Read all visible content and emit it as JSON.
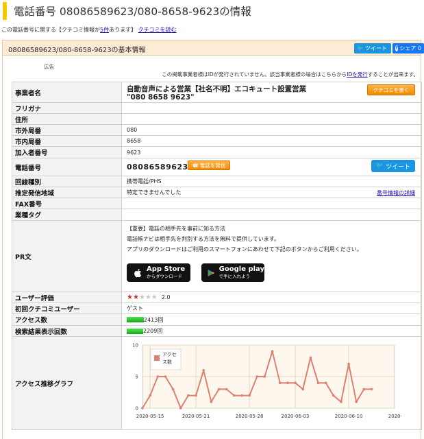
{
  "title": "電話番号 08086589623/080-8658-9623の情報",
  "info_line": {
    "prefix": "この電話番号に関する【クチコミ情報が",
    "count_link": "5件",
    "suffix": "あります】",
    "read_link": "クチコミを読む"
  },
  "section": {
    "title": "08086589623/080-8658-9623の基本情報",
    "tweet_label": "ツイート",
    "share_label": "シェア 0"
  },
  "ad_label": "広告",
  "id_note": {
    "prefix": "この掲載事業者様はIDが発行されていません。該当事業者様の場合はこちらから",
    "link": "IDを発行",
    "suffix": "することが出来ます。"
  },
  "labels": {
    "business_name": "事業者名",
    "furigana": "フリガナ",
    "address": "住所",
    "area_code": "市外局番",
    "local_code": "市内局番",
    "subscriber_no": "加入者番号",
    "phone_no": "電話番号",
    "line_type": "回線種別",
    "origin_area": "推定発信地域",
    "fax": "FAX番号",
    "industry_tag": "業種タグ",
    "pr": "PR文",
    "user_rating": "ユーザー評価",
    "first_reviewer": "初回クチコミユーザー",
    "access_count": "アクセス数",
    "search_count": "検索結果表示回数",
    "access_graph": "アクセス推移グラフ"
  },
  "values": {
    "business_name_line1": "自動音声による営業【社名不明】エコキュート設置営業",
    "business_name_line2": "\"080 8658 9623\"",
    "review_button": "クチコミを書く",
    "furigana": "",
    "address": "",
    "area_code": "080",
    "local_code": "8658",
    "subscriber_no": "9623",
    "phone_no": "08086589623",
    "call_button": "電話を発信",
    "tweet_button": "ツイート",
    "line_type": "携帯電話/PHS",
    "origin_area": "特定できませんでした",
    "detail_link": "番号情報の詳細",
    "fax": "",
    "industry_tag": "",
    "pr_line1": "【重要】電話の相手先を事前に知る方法",
    "pr_line2": "電話帳ナビは相手先を判別する方法を無料で提供しています。",
    "pr_line3": "アプリのダウンロードはご利用のスマートフォンにあわせて下記のボタンからご利用ください。",
    "app_store_main": "App Store",
    "app_store_sub": "からダウンロード",
    "google_play_main": "Google play",
    "google_play_sub": "で手に入れよう",
    "rating_value": "2.0",
    "rating_stars": 2,
    "rating_max": 5,
    "first_reviewer": "ゲスト",
    "access_count": "2413回",
    "search_count": "2209回"
  },
  "colors": {
    "accent": "#f6c800",
    "twitter": "#1b95e0",
    "facebook": "#1877f2",
    "orange_button": "#f08c00",
    "chart_line": "#e07f70",
    "meter": "#22bb22"
  },
  "icons": {
    "tweet": "twitter-bird-icon",
    "share": "facebook-icon",
    "call": "phone-icon",
    "app_store": "apple-icon",
    "google_play": "google-play-icon",
    "rating": "star-icon"
  },
  "chart_data": {
    "type": "line",
    "legend": "アクセス数",
    "legend_placement": "top-left",
    "grid": true,
    "ylim": [
      0,
      10
    ],
    "y_ticks": [
      0,
      5,
      10
    ],
    "x_tick_labels": [
      "2020-05-15",
      "2020-05-21",
      "2020-05-28",
      "2020-06-03",
      "2020-06-10",
      "2020-06-17"
    ],
    "x": [
      "2020-05-14",
      "2020-05-15",
      "2020-05-16",
      "2020-05-17",
      "2020-05-18",
      "2020-05-19",
      "2020-05-20",
      "2020-05-21",
      "2020-05-22",
      "2020-05-23",
      "2020-05-24",
      "2020-05-25",
      "2020-05-26",
      "2020-05-27",
      "2020-05-28",
      "2020-05-29",
      "2020-05-30",
      "2020-05-31",
      "2020-06-01",
      "2020-06-02",
      "2020-06-03",
      "2020-06-04",
      "2020-06-05",
      "2020-06-06",
      "2020-06-07",
      "2020-06-08",
      "2020-06-09",
      "2020-06-10",
      "2020-06-11",
      "2020-06-12",
      "2020-06-13",
      "2020-06-14",
      "2020-06-15",
      "2020-06-16"
    ],
    "values": [
      0,
      2,
      5,
      5,
      3,
      0,
      2,
      2,
      6,
      1,
      3,
      3,
      2,
      2,
      2,
      5,
      5,
      9,
      4,
      4,
      4,
      3,
      8,
      4,
      4,
      2,
      1,
      7,
      1,
      3,
      3
    ],
    "series": [
      {
        "name": "アクセス数",
        "values": [
          0,
          2,
          5,
          5,
          3,
          0,
          2,
          2,
          6,
          1,
          3,
          3,
          2,
          2,
          2,
          5,
          5,
          9,
          4,
          4,
          4,
          3,
          8,
          4,
          4,
          2,
          1,
          7,
          1,
          3,
          3
        ]
      }
    ]
  }
}
